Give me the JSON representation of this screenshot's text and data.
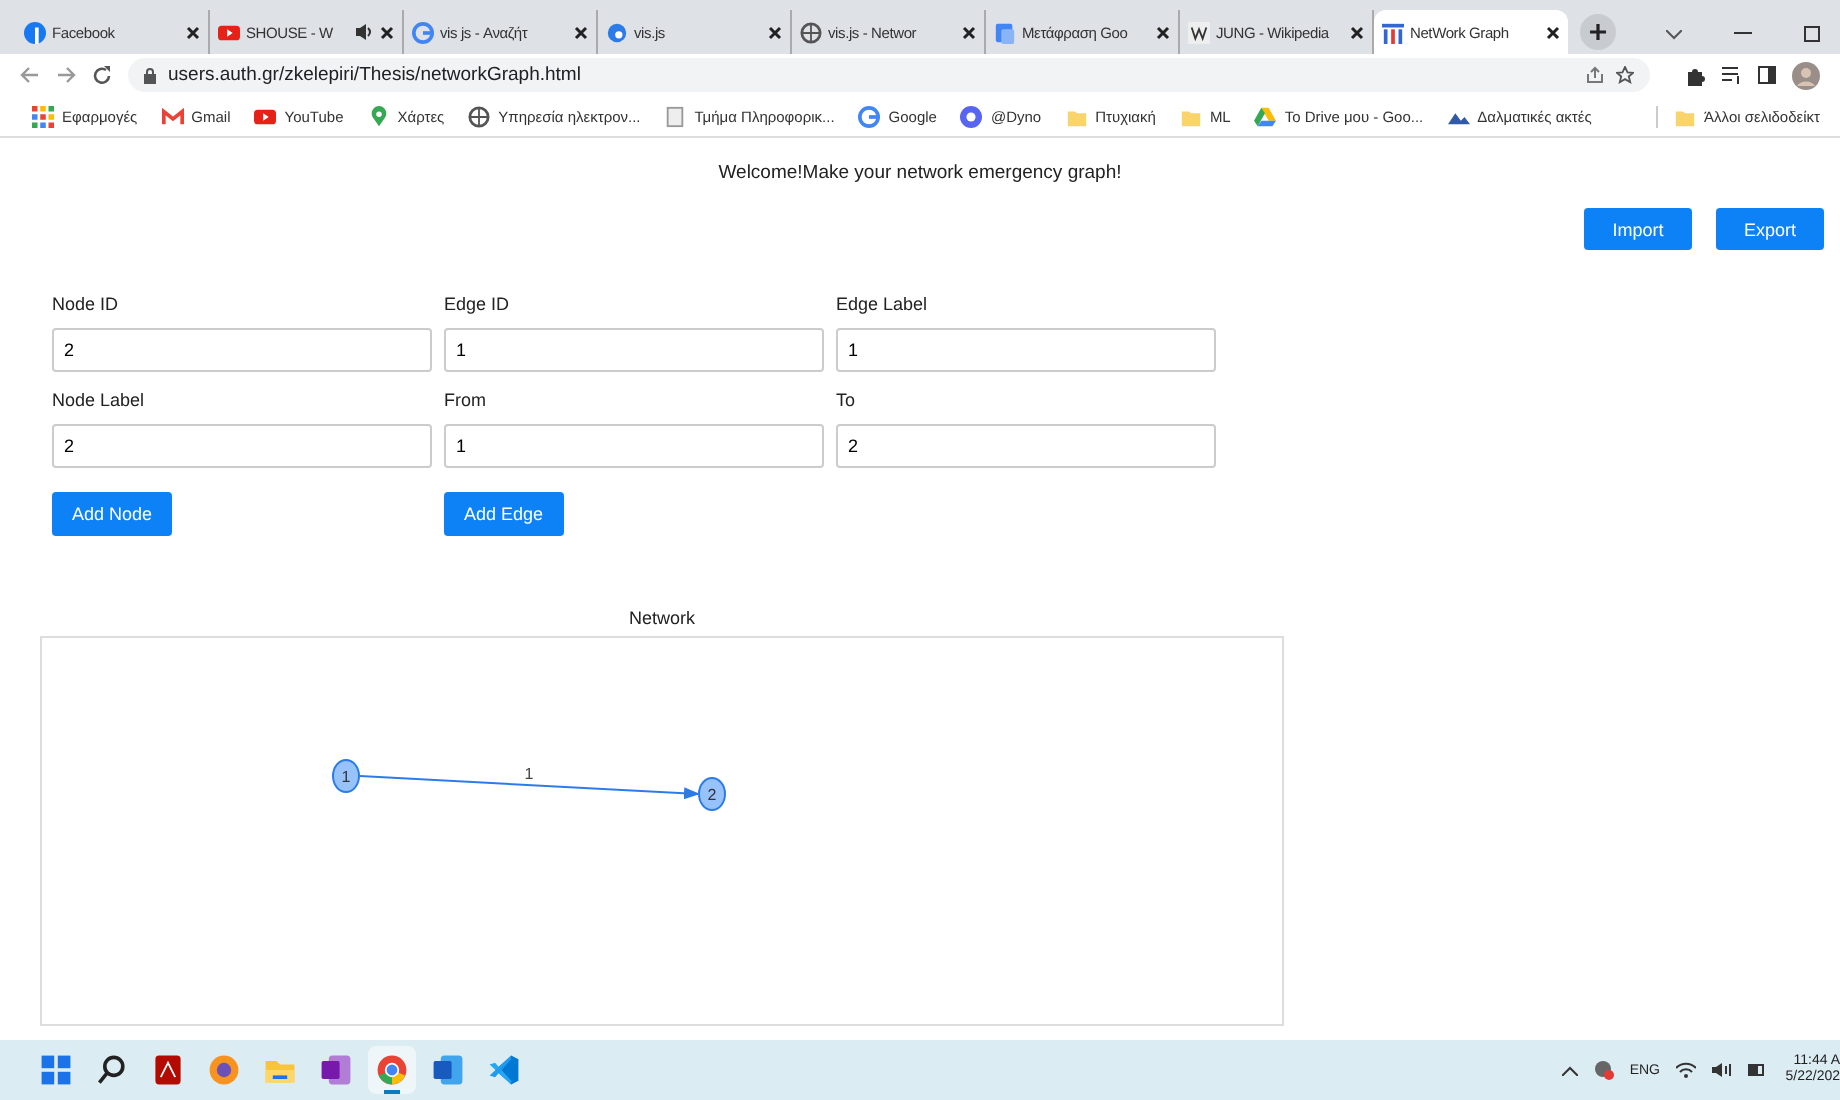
{
  "browser": {
    "tabs": [
      {
        "title": "Facebook",
        "kind": "facebook",
        "selected": false
      },
      {
        "title": "SHOUSE - W",
        "kind": "youtube",
        "audio": true,
        "selected": false
      },
      {
        "title": "vis js - Αναζήτ",
        "kind": "google",
        "selected": false
      },
      {
        "title": "vis.js",
        "kind": "visjs",
        "selected": false
      },
      {
        "title": "vis.js - Networ",
        "kind": "globe",
        "selected": false
      },
      {
        "title": "Μετάφραση Goo",
        "kind": "translate",
        "selected": false
      },
      {
        "title": "JUNG - Wikipedia",
        "kind": "wiki",
        "selected": false
      },
      {
        "title": "NetWork Graph",
        "kind": "chart",
        "selected": true
      }
    ],
    "address": "users.auth.gr/zkelepiri/Thesis/networkGraph.html",
    "bookmarks": [
      {
        "label": "Εφαρμογές",
        "kind": "apps"
      },
      {
        "label": "Gmail",
        "kind": "gmail"
      },
      {
        "label": "YouTube",
        "kind": "youtube"
      },
      {
        "label": "Χάρτες",
        "kind": "maps"
      },
      {
        "label": "Υπηρεσία ηλεκτρον...",
        "kind": "globe"
      },
      {
        "label": "Τμήμα Πληροφορικ...",
        "kind": "page"
      },
      {
        "label": "Google",
        "kind": "google"
      },
      {
        "label": "@Dyno",
        "kind": "dyno"
      },
      {
        "label": "Πτυχιακή",
        "kind": "folder"
      },
      {
        "label": "ML",
        "kind": "folder"
      },
      {
        "label": "Το Drive μου - Goo...",
        "kind": "drive"
      },
      {
        "label": "Δαλματικές ακτές",
        "kind": "mountain"
      }
    ],
    "other_bookmarks": "Άλλοι σελιδοδείκτ"
  },
  "page": {
    "welcome": "Welcome!Make your network emergency graph!",
    "buttons": [
      "Import",
      "Export"
    ],
    "node_form": {
      "fields": [
        {
          "label": "Node ID",
          "value": "2"
        },
        {
          "label": "Node Label",
          "value": "2"
        }
      ],
      "button": "Add Node"
    },
    "edge_form": {
      "fields": [
        {
          "label": "Edge ID",
          "value": "1"
        },
        {
          "label": "From",
          "value": "1"
        }
      ],
      "button": "Add Edge"
    },
    "edge_form_2": {
      "fields": [
        {
          "label": "Edge Label",
          "value": "1"
        },
        {
          "label": "To",
          "value": "2"
        }
      ]
    },
    "network": {
      "title": "Network",
      "nodes": [
        {
          "label": "1"
        },
        {
          "label": "2"
        }
      ],
      "edges": [
        {
          "label": "1"
        }
      ]
    }
  },
  "taskbar": {
    "apps": [
      {
        "kind": "start",
        "active": false
      },
      {
        "kind": "search",
        "active": false
      },
      {
        "kind": "pdf",
        "active": false
      },
      {
        "kind": "browser2",
        "active": false
      },
      {
        "kind": "folder",
        "active": false
      },
      {
        "kind": "onenote",
        "active": false
      },
      {
        "kind": "chrome",
        "active": true
      },
      {
        "kind": "word",
        "active": false
      },
      {
        "kind": "vscode",
        "active": false
      }
    ],
    "language": "ENG",
    "time": "11:44 A",
    "date": "5/22/202"
  }
}
